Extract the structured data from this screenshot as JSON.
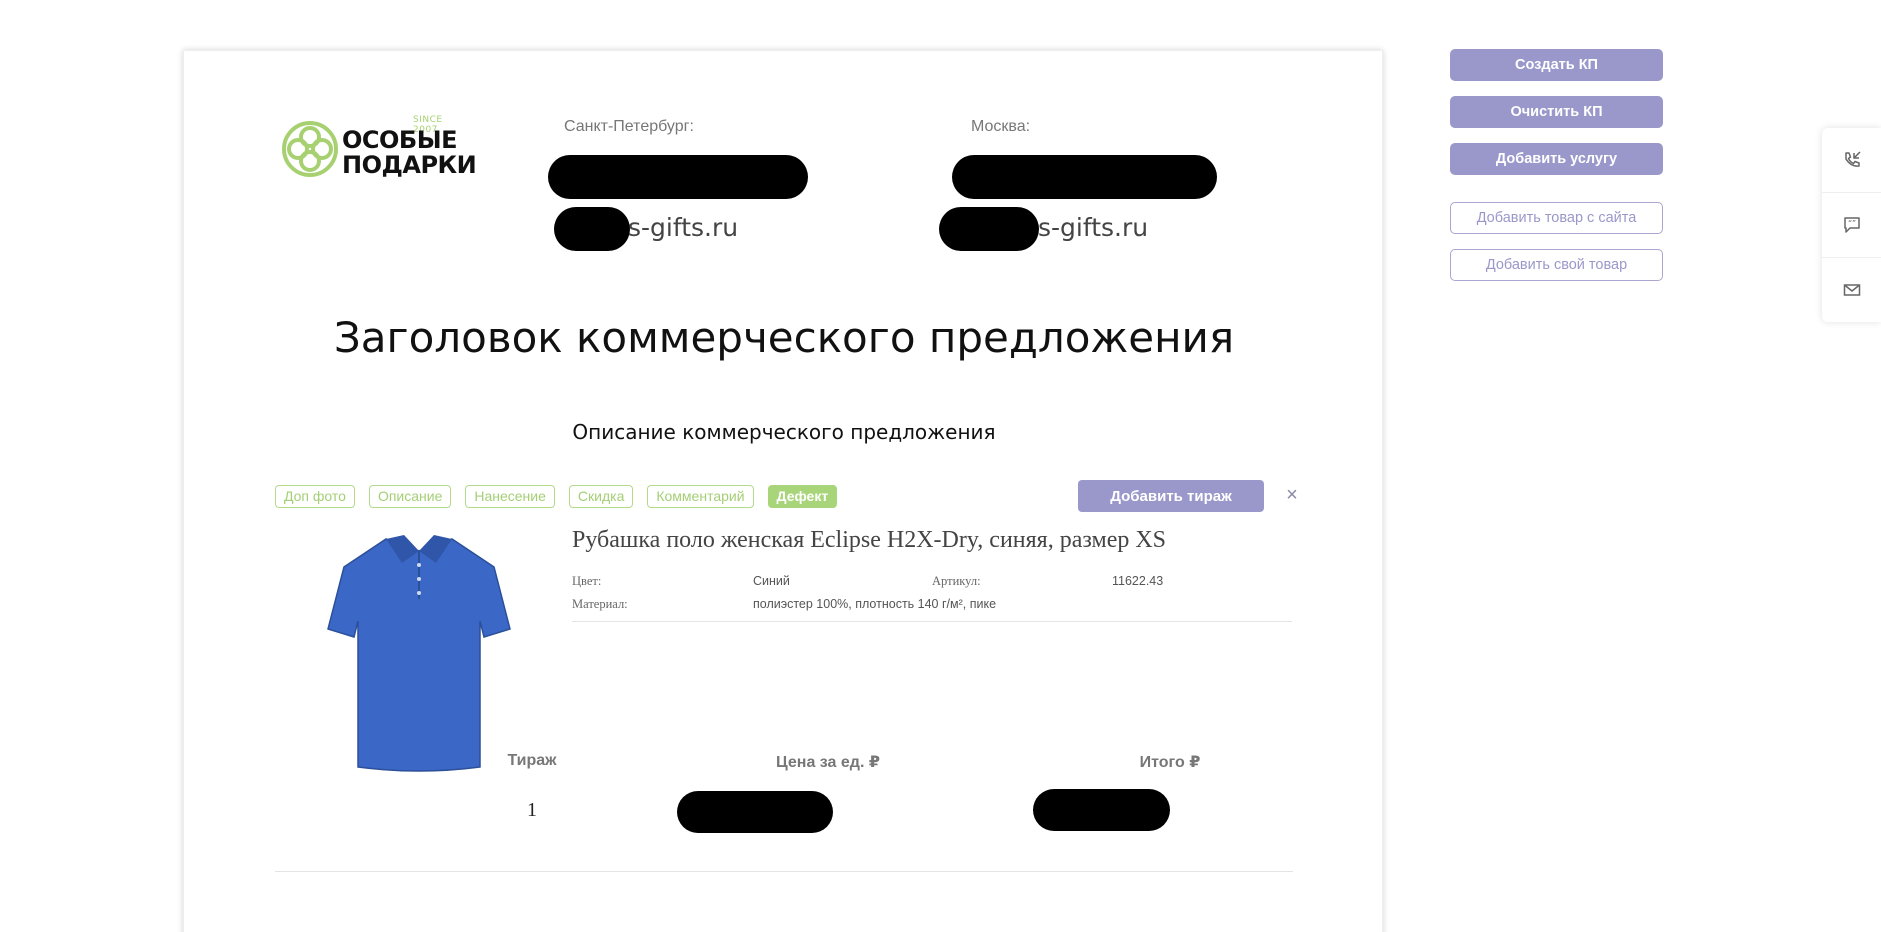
{
  "header": {
    "logo": {
      "since": "SINCE 2007",
      "line1": "ОСОБЫЕ",
      "line2": "ПОДАРКИ",
      "accent": "#a7d171"
    },
    "spb": {
      "label": "Санкт-Петербург:",
      "email_suffix": "s-gifts.ru"
    },
    "msk": {
      "label": "Москва:",
      "email_suffix": "s-gifts.ru"
    }
  },
  "offer": {
    "title": "Заголовок коммерческого предложения",
    "description": "Описание коммерческого предложения"
  },
  "item": {
    "tags": [
      "Доп фото",
      "Описание",
      "Нанесение",
      "Скидка",
      "Комментарий",
      "Дефект"
    ],
    "active_tag": "Дефект",
    "add_run_label": "Добавить тираж",
    "close_label": "×",
    "name": "Рубашка поло женская Eclipse H2X-Dry, синяя, размер XS",
    "color_label": "Цвет:",
    "color_value": "Синий",
    "article_label": "Артикул:",
    "article_value": "11622.43",
    "material_label": "Материал:",
    "material_value": "полиэстер 100%, плотность 140 г/м², пике",
    "shirt_color": "#3b68c6",
    "columns": {
      "qty": "Тираж",
      "price": "Цена за ед. ₽",
      "total": "Итого ₽"
    },
    "qty_value": "1"
  },
  "sidebar": {
    "create": "Создать КП",
    "clear": "Очистить КП",
    "add_service": "Добавить услугу",
    "add_from_site": "Добавить товар с сайта",
    "add_own": "Добавить свой товар"
  },
  "widget": {
    "icons": [
      "phone-callback-icon",
      "chat-quote-icon",
      "mail-icon"
    ]
  }
}
